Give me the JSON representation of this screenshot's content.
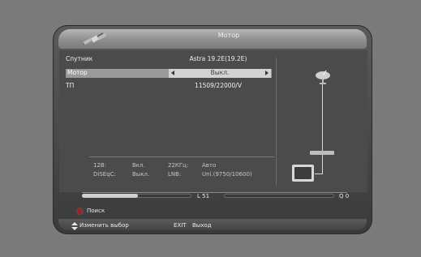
{
  "header": {
    "title": "Мотор"
  },
  "settings": [
    {
      "label": "Спутник",
      "value": "Astra 19.2E(19.2E)"
    },
    {
      "label": "Мотор",
      "value": "Выкл."
    },
    {
      "label": "ТП",
      "value": "11509/22000/V"
    }
  ],
  "info": {
    "v12_label": "12В:",
    "v12_value": "Вкл.",
    "khz_label": "22КГц:",
    "khz_value": "Авто",
    "diseqc_label": "DiSEqC:",
    "diseqc_value": "Выкл.",
    "lnb_label": "LNB:",
    "lnb_value": "Uni.(9750/10600)"
  },
  "signal": {
    "level_text": "L 51",
    "level_fraction": 0.51,
    "quality_text": "Q 0",
    "quality_fraction": 0.0
  },
  "footer": {
    "search_label": "Поиск",
    "change_label": "Изменить выбор",
    "exit_key": "EXIT",
    "exit_label": "Выход",
    "red_button_color": "#a02020"
  },
  "icons": [
    "satellite-icon",
    "dish-icon",
    "receiver-icon",
    "tv-icon",
    "left-arrow-icon",
    "right-arrow-icon",
    "up-down-arrows-icon"
  ]
}
